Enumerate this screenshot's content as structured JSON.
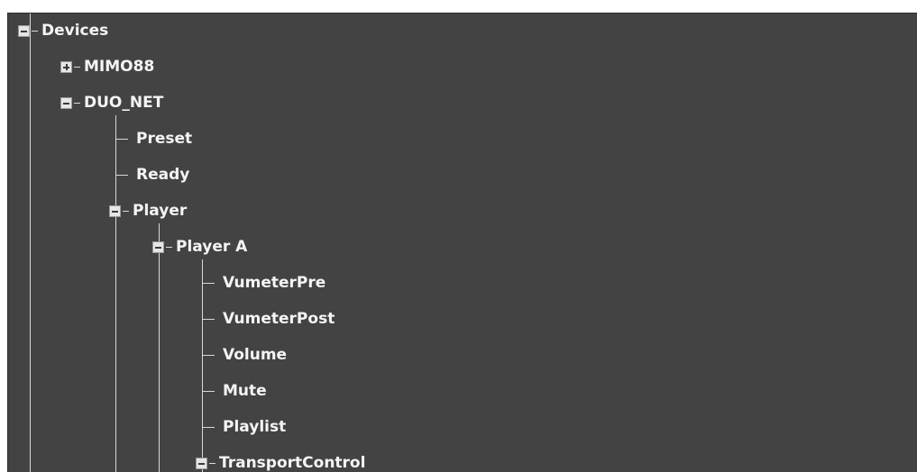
{
  "tree": {
    "root": {
      "label": "Devices",
      "expanded": true
    },
    "mimo88": {
      "label": "MIMO88",
      "expanded": false
    },
    "duo_net": {
      "label": "DUO_NET",
      "expanded": true
    },
    "preset": {
      "label": "Preset"
    },
    "ready": {
      "label": "Ready"
    },
    "player": {
      "label": "Player",
      "expanded": true
    },
    "player_a": {
      "label": "Player A",
      "expanded": true
    },
    "vumeter_pre": {
      "label": "VumeterPre"
    },
    "vumeter_post": {
      "label": "VumeterPost"
    },
    "volume": {
      "label": "Volume"
    },
    "mute": {
      "label": "Mute"
    },
    "playlist": {
      "label": "Playlist"
    },
    "transport_control": {
      "label": "TransportControl",
      "expanded": true
    }
  },
  "colors": {
    "panel_bg": "#434343",
    "text": "#f4f4f4",
    "connector": "#d8d8d8",
    "toggle_bg": "#e6e6e6"
  }
}
